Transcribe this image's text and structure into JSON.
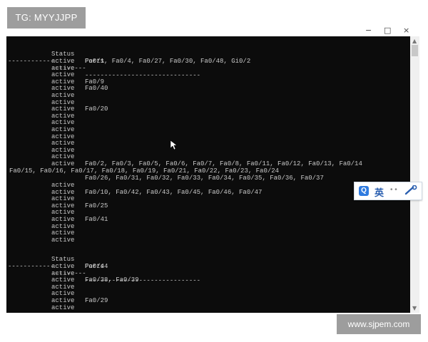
{
  "watermark_top": "TG: MYYJJPP",
  "watermark_bottom": "www.sjpem.com",
  "window_controls": {
    "minimize": "−",
    "maximize": "□",
    "close": "×"
  },
  "ime": {
    "logo": "Q",
    "mode": "英",
    "dots": "• •",
    "tool_icon": "wrench-icon"
  },
  "console": {
    "header1": {
      "status": "Status",
      "ports": "Ports"
    },
    "header2": {
      "status": "Status",
      "ports": "Ports"
    },
    "dashes": {
      "col1": "------------",
      "col2": "---------",
      "col3": "------------------------------"
    },
    "block1": [
      {
        "status": "active",
        "ports": "Fa0/1, Fa0/4, Fa0/27, Fa0/30, Fa0/48, Gi0/2"
      },
      {
        "status": "active",
        "ports": ""
      },
      {
        "status": "active",
        "ports": ""
      },
      {
        "status": "active",
        "ports": "Fa0/9"
      },
      {
        "status": "active",
        "ports": "Fa0/40"
      },
      {
        "status": "active",
        "ports": ""
      },
      {
        "status": "active",
        "ports": ""
      },
      {
        "status": "active",
        "ports": "Fa0/20"
      },
      {
        "status": "active",
        "ports": ""
      },
      {
        "status": "active",
        "ports": ""
      },
      {
        "status": "active",
        "ports": ""
      },
      {
        "status": "active",
        "ports": ""
      },
      {
        "status": "active",
        "ports": ""
      },
      {
        "status": "active",
        "ports": ""
      },
      {
        "status": "active",
        "ports": ""
      },
      {
        "status": "active",
        "ports": "Fa0/2, Fa0/3, Fa0/5, Fa0/6, Fa0/7, Fa0/8, Fa0/11, Fa0/12, Fa0/13, Fa0/14"
      }
    ],
    "wrap1": "Fa0/15, Fa0/16, Fa0/17, Fa0/18, Fa0/19, Fa0/21, Fa0/22, Fa0/23, Fa0/24",
    "wrap2": "Fa0/26, Fa0/31, Fa0/32, Fa0/33, Fa0/34, Fa0/35, Fa0/36, Fa0/37",
    "block2": [
      {
        "status": "active",
        "ports": ""
      },
      {
        "status": "active",
        "ports": "Fa0/10, Fa0/42, Fa0/43, Fa0/45, Fa0/46, Fa0/47"
      },
      {
        "status": "active",
        "ports": ""
      },
      {
        "status": "active",
        "ports": "Fa0/25"
      },
      {
        "status": "active",
        "ports": ""
      },
      {
        "status": "active",
        "ports": "Fa0/41"
      },
      {
        "status": "active",
        "ports": ""
      },
      {
        "status": "active",
        "ports": ""
      },
      {
        "status": "active",
        "ports": ""
      }
    ],
    "block3": [
      {
        "status": "active",
        "ports": "Fa0/44"
      },
      {
        "status": "active",
        "ports": ""
      },
      {
        "status": "active",
        "ports": "Fa0/38, Fa0/39"
      },
      {
        "status": "active",
        "ports": ""
      },
      {
        "status": "active",
        "ports": ""
      },
      {
        "status": "active",
        "ports": "Fa0/29"
      },
      {
        "status": "active",
        "ports": ""
      }
    ]
  }
}
